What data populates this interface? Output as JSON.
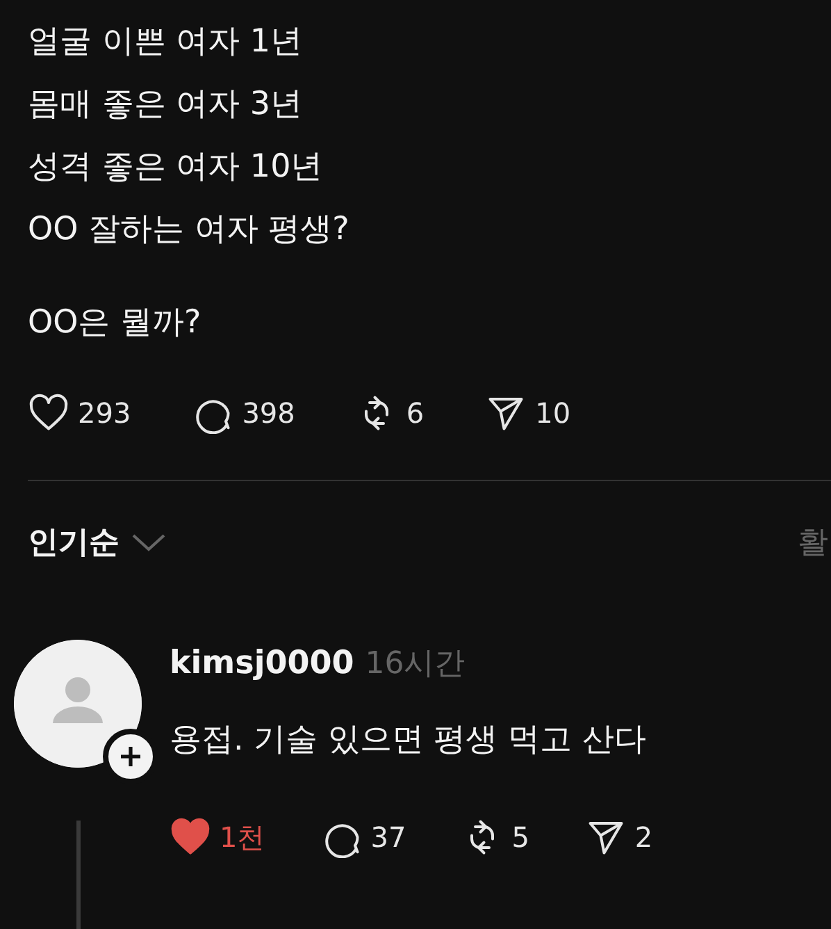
{
  "post": {
    "lines": [
      "얼굴 이쁜 여자 1년",
      "몸매 좋은 여자 3년",
      "성격 좋은 여자 10년",
      "OO 잘하는 여자 평생?"
    ],
    "question": "OO은 뭘까?",
    "actions": {
      "liked": false,
      "likes": "293",
      "comments": "398",
      "reposts": "6",
      "shares": "10"
    }
  },
  "sort": {
    "label": "인기순",
    "right_link": "활"
  },
  "comments": [
    {
      "username": "kimsj0000",
      "time": "16시간",
      "text": "용접. 기술 있으면 평생 먹고 산다",
      "actions": {
        "liked": true,
        "likes": "1천",
        "comments": "37",
        "reposts": "5",
        "shares": "2"
      }
    }
  ]
}
